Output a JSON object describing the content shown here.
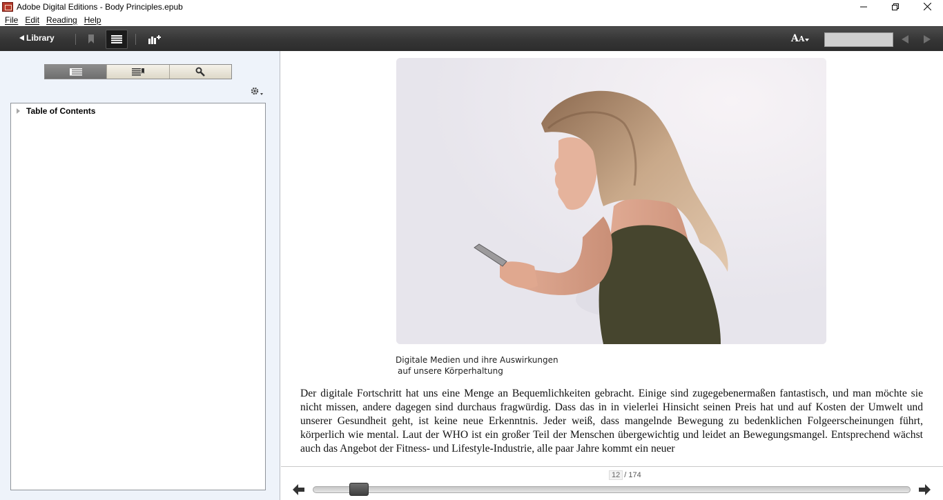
{
  "window": {
    "title": "Adobe Digital Editions - Body Principles.epub"
  },
  "menu": [
    "File",
    "Edit",
    "Reading",
    "Help"
  ],
  "toolbar": {
    "library_label": "Library",
    "font_label_big": "A",
    "font_label_small": "A",
    "search_value": ""
  },
  "sidebar": {
    "toc_title": "Table of Contents"
  },
  "content": {
    "caption_line1": "Digitale Medien und ihre Auswirkungen",
    "caption_line2": "auf unsere Körperhaltung",
    "paragraph": "Der digitale Fortschritt hat uns eine Menge an Bequemlichkeiten gebracht. Einige sind zugegebenermaßen fantastisch, und man möchte sie nicht missen, andere dagegen sind durchaus fragwürdig. Dass das in in vielerlei Hinsicht seinen Preis hat und auf Kosten der Umwelt und unserer Gesundheit geht, ist keine neue Erkenntnis. Jeder weiß, dass mangelnde Bewegung zu bedenklichen Folgeerscheinungen führt, körperlich wie mental. Laut der WHO ist ein großer Teil der Menschen übergewichtig und leidet an Bewegungsmangel. Entsprechend wächst auch das Angebot der Fitness- und Lifestyle-Industrie, alle paar Jahre kommt ein neuer"
  },
  "pagination": {
    "current": "12",
    "total": "/ 174",
    "current_page": 12,
    "total_pages": 174
  }
}
